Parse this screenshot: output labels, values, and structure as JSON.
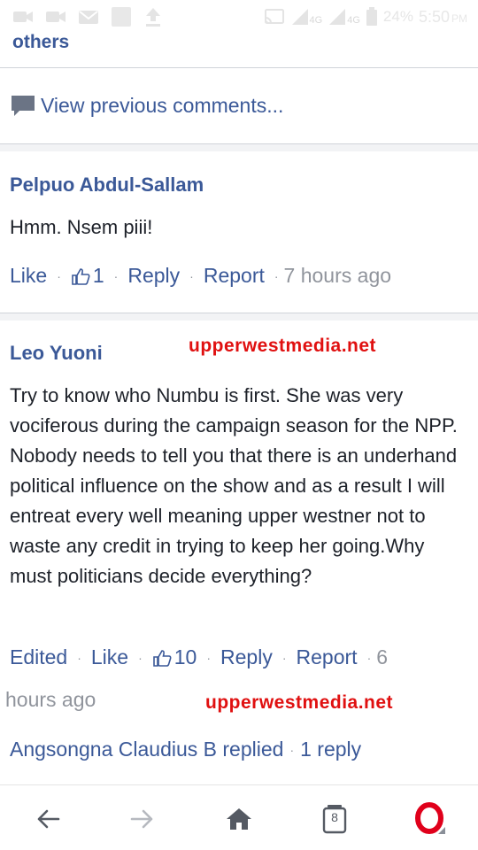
{
  "status_bar": {
    "network_label_1": "4G",
    "network_label_2": "4G",
    "battery": "24%",
    "time": "5:50",
    "ampm": "PM"
  },
  "thread": {
    "others_label": "others",
    "view_previous_label": "View previous comments..."
  },
  "comments": [
    {
      "author": "Pelpuo Abdul-Sallam",
      "text": "Hmm. Nsem piii!",
      "like_label": "Like",
      "like_count": "1",
      "reply_label": "Reply",
      "report_label": "Report",
      "time": "7 hours ago"
    },
    {
      "author": "Leo  Yuoni",
      "text": "Try to know who Numbu is first. She was very vociferous during the campaign season for the NPP. Nobody needs to tell you that there is an underhand political influence on the show and as a result I will entreat every well meaning upper westner not to waste any credit in trying to keep her going.Why must politicians decide everything?",
      "edited_label": "Edited",
      "like_label": "Like",
      "like_count": "10",
      "reply_label": "Reply",
      "report_label": "Report",
      "time_part1": "6",
      "time_part2": "hours ago",
      "replies_summary": "Angsongna Claudius B replied",
      "reply_count": "1 reply"
    }
  ],
  "watermark": "upperwestmedia.net",
  "bottom_nav": {
    "tab_count": "8"
  },
  "colors": {
    "link": "#3b5998",
    "muted": "#90949c",
    "watermark": "#e01010",
    "opera_red": "#e0001b"
  }
}
